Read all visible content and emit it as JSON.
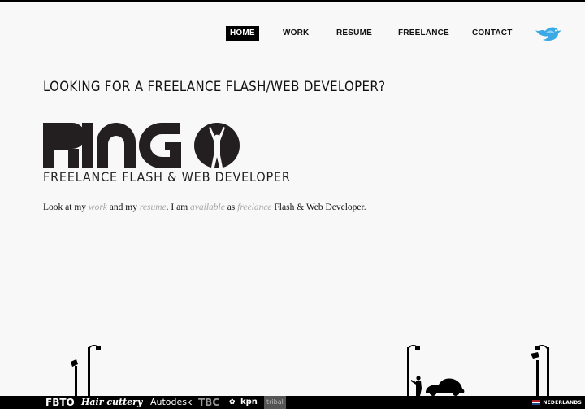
{
  "nav": {
    "items": [
      {
        "label": "HOME",
        "active": true
      },
      {
        "label": "WORK",
        "active": false
      },
      {
        "label": "RESUME",
        "active": false
      },
      {
        "label": "FREELANCE",
        "active": false
      },
      {
        "label": "CONTACT",
        "active": false
      }
    ]
  },
  "twitter_icon": "bird-icon",
  "headline": "LOOKING FOR A FREELANCE FLASH/WEB DEVELOPER?",
  "logo": {
    "text": "RINGO",
    "colors": {
      "letters": "#231f20"
    }
  },
  "tagline": "FREELANCE FLASH & WEB DEVELOPER",
  "intro": {
    "t1": "Look at my ",
    "work": "work",
    "t2": " and my ",
    "resume": "resume",
    "t3": ". I am ",
    "available": "available",
    "t4": " as ",
    "freelance": "freelance",
    "t5": " Flash & Web Developer."
  },
  "footer": {
    "clients": [
      "FBTO",
      "Hair cuttery",
      "Autodesk",
      "TBC",
      "kpn",
      "tribal"
    ],
    "language": "NEDERLANDS",
    "flag_colors": [
      "#ae1c28",
      "#ffffff",
      "#21468b"
    ]
  },
  "colors": {
    "accent": "#000000",
    "link": "#a8a8a8",
    "bird": "#3aa9e6",
    "background": "#f8f8f8"
  }
}
